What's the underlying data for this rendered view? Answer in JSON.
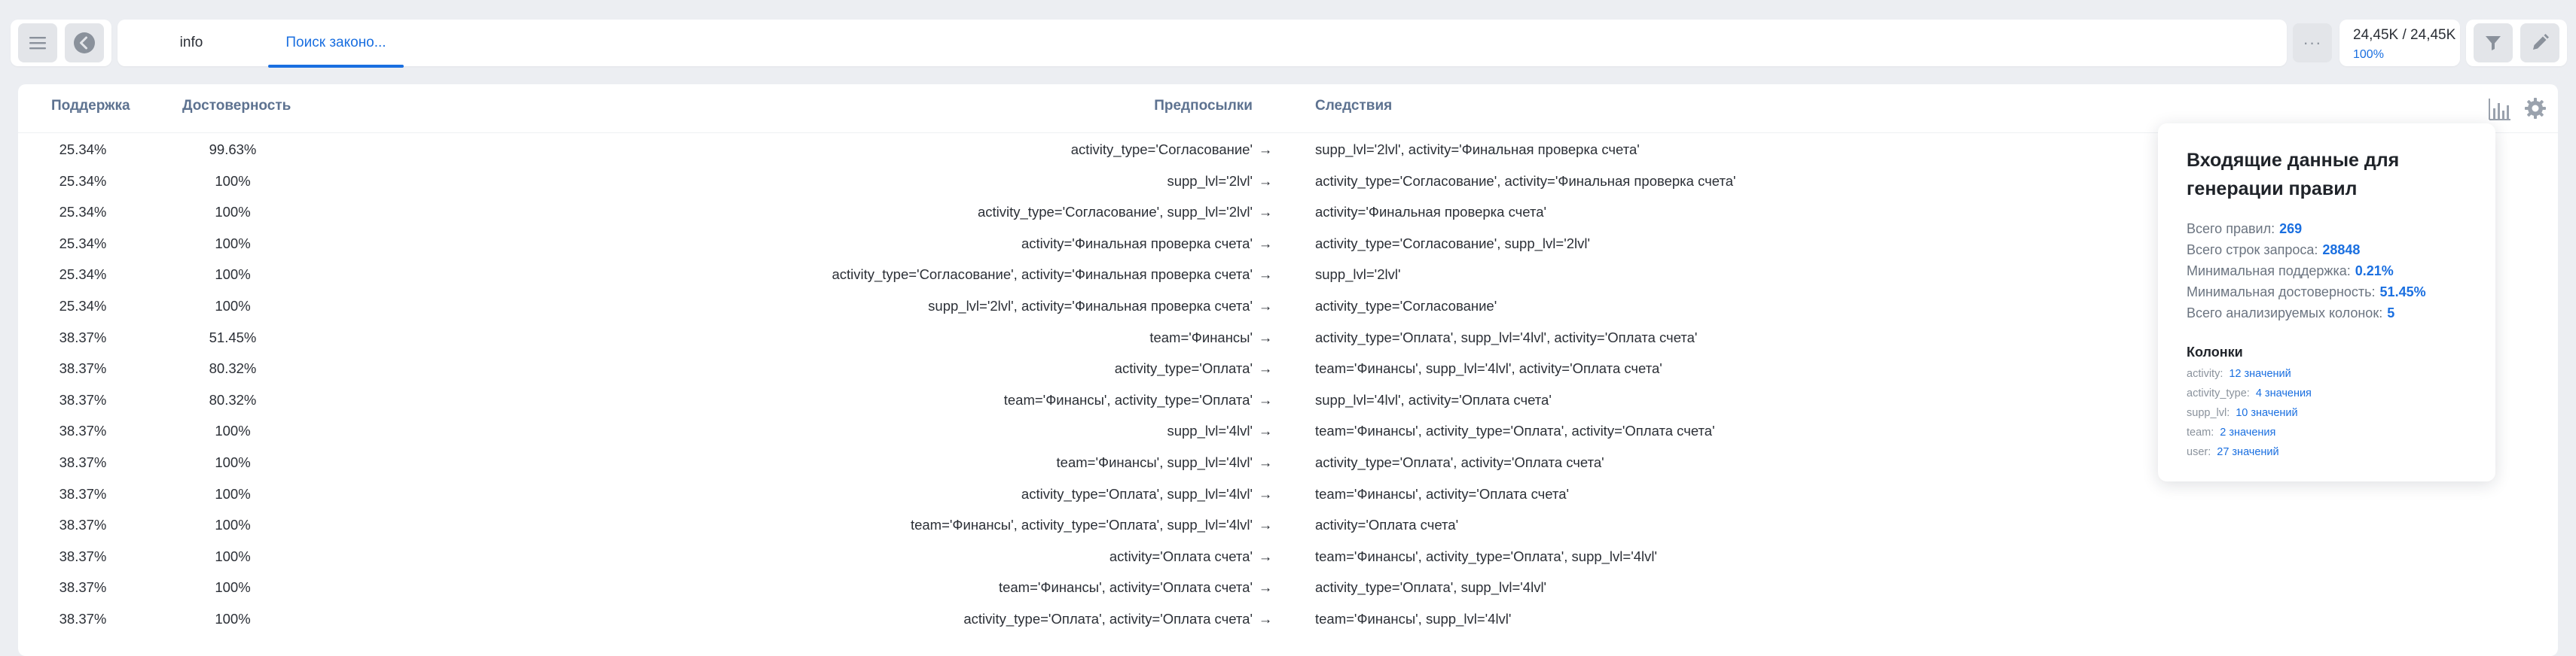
{
  "toolbar": {
    "menu_icon": "hamburger-menu-icon",
    "back_icon": "back-arrow-icon",
    "tabs": [
      {
        "label": "info"
      },
      {
        "label": "Поиск законо..."
      }
    ],
    "more_label": "···",
    "counts": "24,45K / 24,45K",
    "percent": "100%",
    "filter_icon": "filter-icon",
    "edit_icon": "pencil-icon"
  },
  "table": {
    "headers": {
      "support": "Поддержка",
      "confidence": "Достоверность",
      "premises": "Предпосылки",
      "consequents": "Следствия"
    },
    "arrow": "→",
    "rows": [
      {
        "support": "25.34%",
        "confidence": "99.63%",
        "premise": "activity_type='Согласование'",
        "consequent": "supp_lvl='2lvl', activity='Финальная проверка счета'"
      },
      {
        "support": "25.34%",
        "confidence": "100%",
        "premise": "supp_lvl='2lvl'",
        "consequent": "activity_type='Согласование', activity='Финальная проверка счета'"
      },
      {
        "support": "25.34%",
        "confidence": "100%",
        "premise": "activity_type='Согласование', supp_lvl='2lvl'",
        "consequent": "activity='Финальная проверка счета'"
      },
      {
        "support": "25.34%",
        "confidence": "100%",
        "premise": "activity='Финальная проверка счета'",
        "consequent": "activity_type='Согласование', supp_lvl='2lvl'"
      },
      {
        "support": "25.34%",
        "confidence": "100%",
        "premise": "activity_type='Согласование', activity='Финальная проверка счета'",
        "consequent": "supp_lvl='2lvl'"
      },
      {
        "support": "25.34%",
        "confidence": "100%",
        "premise": "supp_lvl='2lvl', activity='Финальная проверка счета'",
        "consequent": "activity_type='Согласование'"
      },
      {
        "support": "38.37%",
        "confidence": "51.45%",
        "premise": "team='Финансы'",
        "consequent": "activity_type='Оплата', supp_lvl='4lvl', activity='Оплата счета'"
      },
      {
        "support": "38.37%",
        "confidence": "80.32%",
        "premise": "activity_type='Оплата'",
        "consequent": "team='Финансы', supp_lvl='4lvl', activity='Оплата счета'"
      },
      {
        "support": "38.37%",
        "confidence": "80.32%",
        "premise": "team='Финансы', activity_type='Оплата'",
        "consequent": "supp_lvl='4lvl', activity='Оплата счета'"
      },
      {
        "support": "38.37%",
        "confidence": "100%",
        "premise": "supp_lvl='4lvl'",
        "consequent": "team='Финансы', activity_type='Оплата', activity='Оплата счета'"
      },
      {
        "support": "38.37%",
        "confidence": "100%",
        "premise": "team='Финансы', supp_lvl='4lvl'",
        "consequent": "activity_type='Оплата', activity='Оплата счета'"
      },
      {
        "support": "38.37%",
        "confidence": "100%",
        "premise": "activity_type='Оплата', supp_lvl='4lvl'",
        "consequent": "team='Финансы', activity='Оплата счета'"
      },
      {
        "support": "38.37%",
        "confidence": "100%",
        "premise": "team='Финансы', activity_type='Оплата', supp_lvl='4lvl'",
        "consequent": "activity='Оплата счета'"
      },
      {
        "support": "38.37%",
        "confidence": "100%",
        "premise": "activity='Оплата счета'",
        "consequent": "team='Финансы', activity_type='Оплата', supp_lvl='4lvl'"
      },
      {
        "support": "38.37%",
        "confidence": "100%",
        "premise": "team='Финансы', activity='Оплата счета'",
        "consequent": "activity_type='Оплата', supp_lvl='4lvl'"
      },
      {
        "support": "38.37%",
        "confidence": "100%",
        "premise": "activity_type='Оплата', activity='Оплата счета'",
        "consequent": "team='Финансы', supp_lvl='4lvl'"
      }
    ],
    "chart_icon": "bar-chart-icon",
    "settings_icon": "gear-icon"
  },
  "info_panel": {
    "title": "Входящие данные для генерации правил",
    "stats": [
      {
        "label": "Всего правил:",
        "value": "269"
      },
      {
        "label": "Всего строк запроса:",
        "value": "28848"
      },
      {
        "label": "Минимальная поддержка:",
        "value": "0.21%"
      },
      {
        "label": "Минимальная достоверность:",
        "value": "51.45%"
      },
      {
        "label": "Всего анализируемых колонок:",
        "value": "5"
      }
    ],
    "columns_title": "Колонки",
    "columns": [
      {
        "name": "activity:",
        "count": "12 значений"
      },
      {
        "name": "activity_type:",
        "count": "4 значения"
      },
      {
        "name": "supp_lvl:",
        "count": "10 значений"
      },
      {
        "name": "team:",
        "count": "2 значения"
      },
      {
        "name": "user:",
        "count": "27 значений"
      }
    ]
  },
  "colors": {
    "accent": "#1a6fe0",
    "background": "#eceef2",
    "header_text": "#5d7290"
  }
}
